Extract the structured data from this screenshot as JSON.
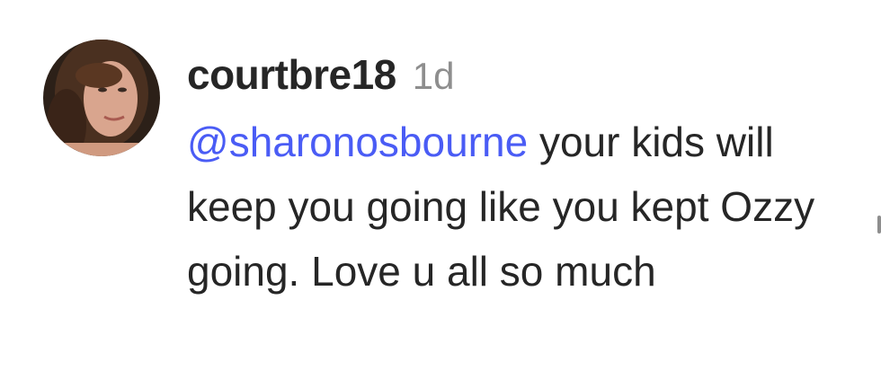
{
  "comment": {
    "username": "courtbre18",
    "timestamp": "1d",
    "mention": "@sharonosbourne",
    "text": " your kids will keep you going like you kept Ozzy going. Love u all so much"
  },
  "colors": {
    "mention": "#4a5cf5",
    "username": "#262626",
    "timestamp": "#8e8e8e",
    "text": "#262626"
  }
}
